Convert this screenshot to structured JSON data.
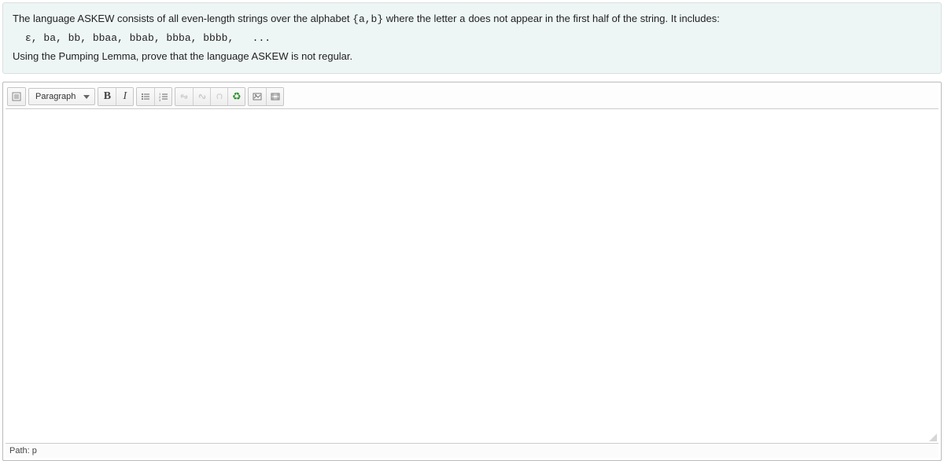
{
  "question": {
    "sentence1_a": "The language ASKEW consists of all even-length strings over the alphabet ",
    "alphabet": "{a,b}",
    "sentence1_b": " where the letter ",
    "letter": "a",
    "sentence1_c": " does not appear in the first half of the string.  It includes:",
    "examples": "ε, ba, bb, bbaa, bbab, bbba, bbbb,   ...",
    "sentence2": "Using the Pumping Lemma, prove that the language ASKEW is not regular."
  },
  "toolbar": {
    "paragraph_label": "Paragraph"
  },
  "status": {
    "path": "Path: p"
  }
}
